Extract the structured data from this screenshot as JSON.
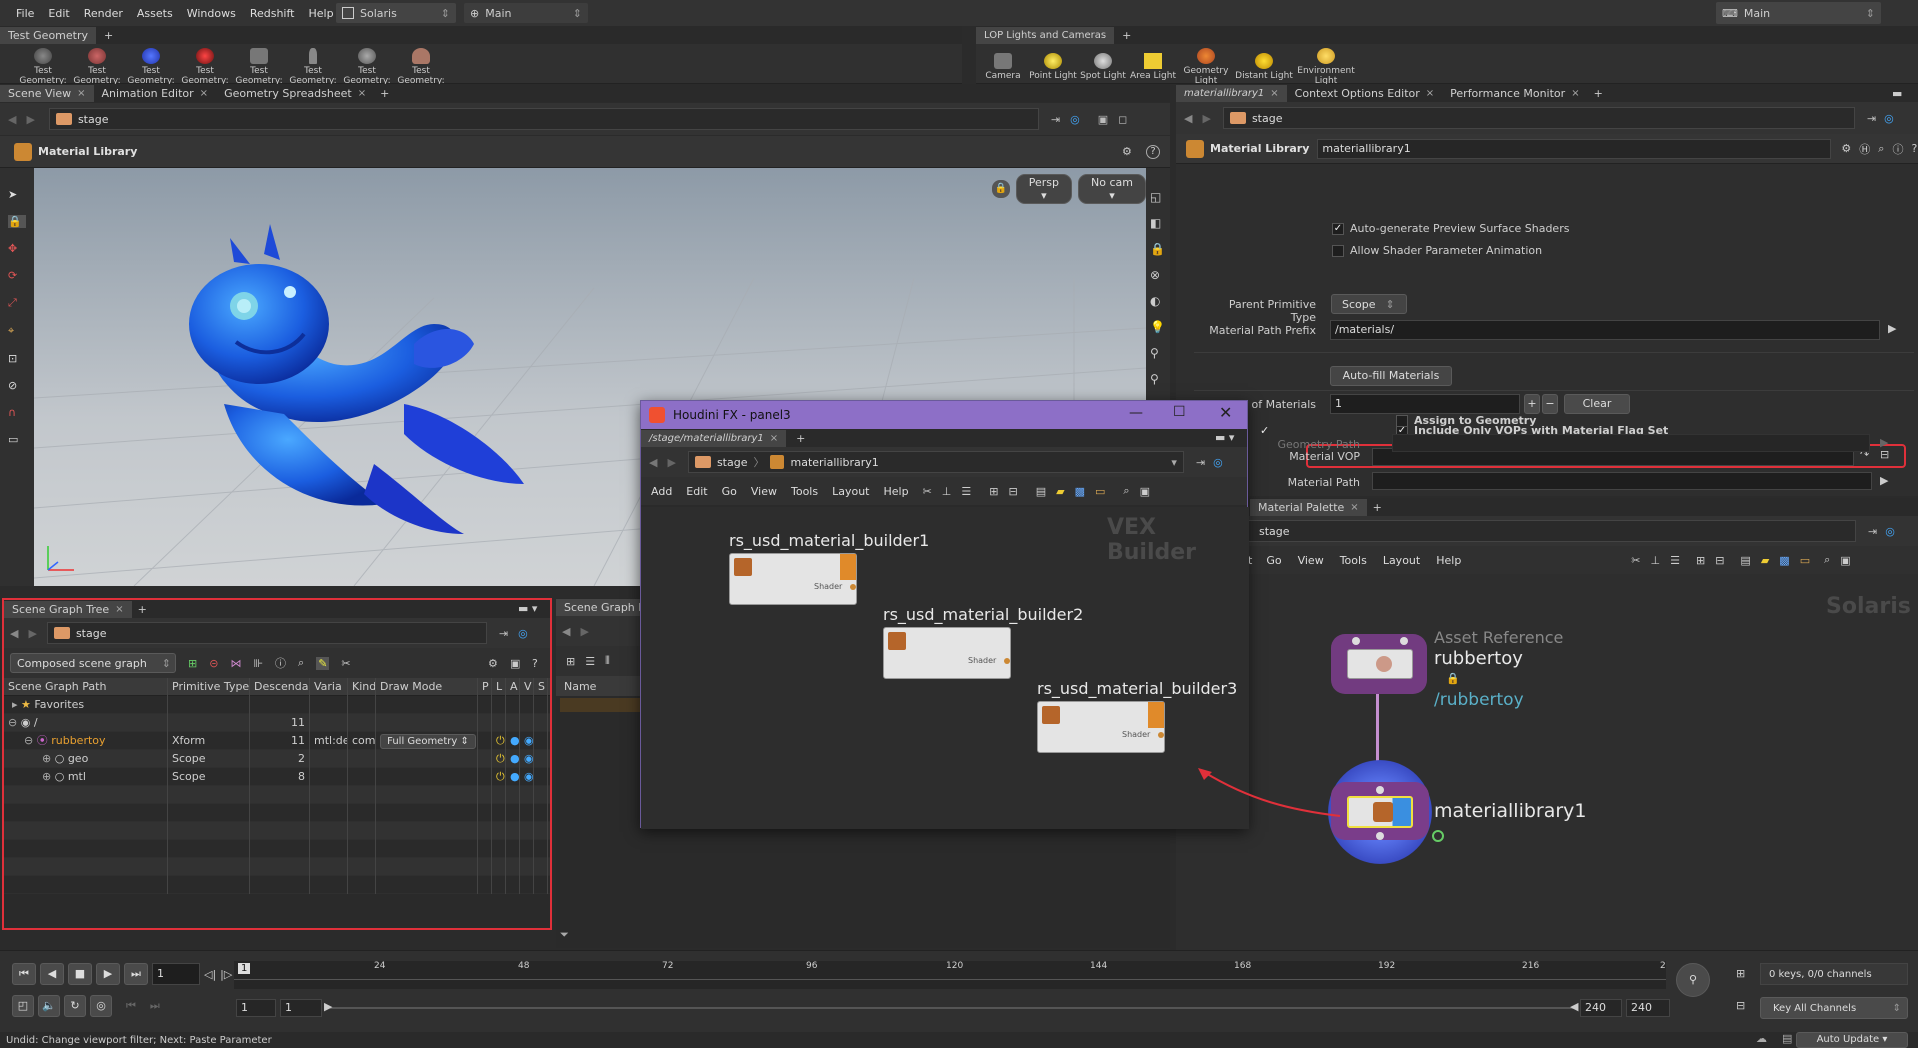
{
  "menubar": {
    "items": [
      "File",
      "Edit",
      "Render",
      "Assets",
      "Windows",
      "Redshift",
      "Help"
    ],
    "desktop": "Solaris",
    "context": "Main",
    "right_context": "Main"
  },
  "shelf_left": {
    "tab": "Test Geometry",
    "tools": [
      "Test Geometry: C...",
      "Test Geometry: P...",
      "Test Geometry: R...",
      "Test Geometry: S...",
      "Test Geometry: S...",
      "Test Geometry: T...",
      "Test Geometry: T...",
      "Test Geometry: T..."
    ]
  },
  "shelf_right": {
    "tab": "LOP Lights and Cameras",
    "tools": [
      "Camera",
      "Point Light",
      "Spot Light",
      "Area Light",
      "Geometry Light",
      "Distant Light",
      "Environment Light"
    ]
  },
  "left_top": {
    "tabs": [
      "Scene View",
      "Animation Editor",
      "Geometry Spreadsheet"
    ],
    "path": "stage",
    "title": "Material Library",
    "persp": "Persp",
    "cam": "No cam"
  },
  "scene_graph": {
    "tab": "Scene Graph Tree",
    "tab2": "Scene Graph Deta",
    "path": "stage",
    "mode": "Composed scene graph",
    "columns": [
      "Scene Graph Path",
      "Primitive Type",
      "Descendan",
      "Varia",
      "Kind",
      "Draw Mode",
      "P",
      "L",
      "A",
      "V",
      "S"
    ],
    "rows": [
      {
        "path": "Favorites",
        "type": "",
        "desc": "",
        "var": "",
        "kind": "",
        "draw": ""
      },
      {
        "path": "/",
        "type": "",
        "desc": "11",
        "var": "",
        "kind": "",
        "draw": ""
      },
      {
        "path": "rubbertoy",
        "type": "Xform",
        "desc": "11",
        "var": "mtl:de",
        "kind": "com",
        "draw": "Full Geometry"
      },
      {
        "path": "geo",
        "type": "Scope",
        "desc": "2",
        "var": "",
        "kind": "",
        "draw": ""
      },
      {
        "path": "mtl",
        "type": "Scope",
        "desc": "8",
        "var": "",
        "kind": "",
        "draw": ""
      }
    ],
    "name_col": "Name"
  },
  "param_panel": {
    "tabs": [
      "materiallibrary1",
      "Context Options Editor",
      "Performance Monitor"
    ],
    "path": "stage",
    "node_type": "Material Library",
    "node_name": "materiallibrary1",
    "auto_preview": "Auto-generate Preview Surface Shaders",
    "allow_anim": "Allow Shader Parameter Animation",
    "parent_prim_label": "Parent Primitive Type",
    "parent_prim_value": "Scope",
    "mat_prefix_label": "Material Path Prefix",
    "mat_prefix_value": "/materials/",
    "autofill": "Auto-fill Materials",
    "num_mat_label": "Number of Materials",
    "num_mat_value": "1",
    "clear": "Clear",
    "include_only": "Include Only VOPs with Material Flag Set",
    "mat_vop_label": "Material VOP",
    "mat_path_label": "Material Path",
    "assign_geo": "Assign to Geometry",
    "geo_path_label": "Geometry Path"
  },
  "network_right": {
    "tab": "Material Palette",
    "path": "stage",
    "menu": [
      "Go",
      "View",
      "Tools",
      "Layout",
      "Help"
    ],
    "watermark": "Solaris",
    "node1_type": "Asset Reference",
    "node1_name": "rubbertoy",
    "node1_path": "/rubbertoy",
    "node2_name": "materiallibrary1"
  },
  "float_window": {
    "title": "Houdini FX - panel3",
    "tab": "/stage/materiallibrary1",
    "crumb1": "stage",
    "crumb2": "materiallibrary1",
    "menu": [
      "Add",
      "Edit",
      "Go",
      "View",
      "Tools",
      "Layout",
      "Help"
    ],
    "watermark": "VEX Builder",
    "nodes": [
      "rs_usd_material_builder1",
      "rs_usd_material_builder2",
      "rs_usd_material_builder3"
    ],
    "node_sub": "Shader"
  },
  "timeline": {
    "frame": "1",
    "ticks": [
      "1",
      "24",
      "48",
      "72",
      "96",
      "120",
      "144",
      "168",
      "192",
      "216",
      "2"
    ],
    "start": "1",
    "start2": "1",
    "end": "240",
    "end2": "240",
    "keys": "0 keys, 0/0 channels",
    "key_all": "Key All Channels",
    "auto_update": "Auto Update"
  },
  "status": "Undid: Change viewport filter; Next: Paste Parameter",
  "colors": {
    "accent_red": "#e0303a",
    "node_purple": "#7a3d8a",
    "window_title": "#8d6fc7",
    "mat_blue": "#3a8fe0"
  }
}
